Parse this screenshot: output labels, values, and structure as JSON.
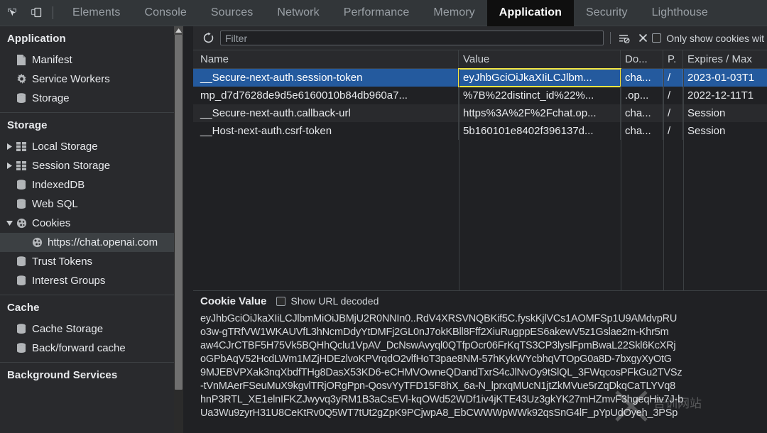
{
  "toolbar": {
    "inspect_icon": "inspect-cursor-icon",
    "device_icon": "device-toolbar-icon",
    "tabs": [
      {
        "label": "Elements",
        "active": false
      },
      {
        "label": "Console",
        "active": false
      },
      {
        "label": "Sources",
        "active": false
      },
      {
        "label": "Network",
        "active": false
      },
      {
        "label": "Performance",
        "active": false
      },
      {
        "label": "Memory",
        "active": false
      },
      {
        "label": "Application",
        "active": true
      },
      {
        "label": "Security",
        "active": false
      },
      {
        "label": "Lighthouse",
        "active": false
      }
    ]
  },
  "sidebar": {
    "sections": [
      {
        "title": "Application",
        "items": [
          {
            "label": "Manifest",
            "icon": "document-icon",
            "twisty": "none",
            "selected": false
          },
          {
            "label": "Service Workers",
            "icon": "gear-icon",
            "twisty": "none",
            "selected": false
          },
          {
            "label": "Storage",
            "icon": "database-icon",
            "twisty": "none",
            "selected": false
          }
        ]
      },
      {
        "title": "Storage",
        "items": [
          {
            "label": "Local Storage",
            "icon": "table-icon",
            "twisty": "collapsed",
            "selected": false
          },
          {
            "label": "Session Storage",
            "icon": "table-icon",
            "twisty": "collapsed",
            "selected": false
          },
          {
            "label": "IndexedDB",
            "icon": "database-icon",
            "twisty": "none",
            "selected": false
          },
          {
            "label": "Web SQL",
            "icon": "database-icon",
            "twisty": "none",
            "selected": false
          },
          {
            "label": "Cookies",
            "icon": "cookie-icon",
            "twisty": "expanded",
            "selected": false
          },
          {
            "label": "https://chat.openai.com",
            "icon": "cookie-icon",
            "twisty": "none",
            "selected": true,
            "deep": true
          },
          {
            "label": "Trust Tokens",
            "icon": "database-icon",
            "twisty": "none",
            "selected": false
          },
          {
            "label": "Interest Groups",
            "icon": "database-icon",
            "twisty": "none",
            "selected": false
          }
        ]
      },
      {
        "title": "Cache",
        "items": [
          {
            "label": "Cache Storage",
            "icon": "database-icon",
            "twisty": "none",
            "selected": false
          },
          {
            "label": "Back/forward cache",
            "icon": "database-icon",
            "twisty": "none",
            "selected": false
          }
        ]
      },
      {
        "title": "Background Services",
        "items": []
      }
    ]
  },
  "filterbar": {
    "refresh_icon": "refresh-icon",
    "filter_placeholder": "Filter",
    "filter_value": "",
    "clear_filtered_icon": "clear-filtered-cookies-icon",
    "clear_all_icon": "close-x-icon",
    "only_show_label": "Only show cookies wit",
    "only_show_checked": false
  },
  "cookie_table": {
    "columns": [
      "Name",
      "Value",
      "Do...",
      "P.",
      "Expires / Max"
    ],
    "rows": [
      {
        "name": "__Secure-next-auth.session-token",
        "value": "eyJhbGciOiJkaXIiLCJlbm...",
        "domain": "cha...",
        "path": "/",
        "expires": "2023-01-03T1",
        "selected": true,
        "value_highlighted": true
      },
      {
        "name": "mp_d7d7628de9d5e6160010b84db960a7...",
        "value": "%7B%22distinct_id%22%...",
        "domain": ".op...",
        "path": "/",
        "expires": "2022-12-11T1",
        "selected": false,
        "value_highlighted": false
      },
      {
        "name": "__Secure-next-auth.callback-url",
        "value": "https%3A%2F%2Fchat.op...",
        "domain": "cha...",
        "path": "/",
        "expires": "Session",
        "selected": false,
        "value_highlighted": false
      },
      {
        "name": "__Host-next-auth.csrf-token",
        "value": "5b160101e8402f396137d...",
        "domain": "cha...",
        "path": "/",
        "expires": "Session",
        "selected": false,
        "value_highlighted": false
      }
    ]
  },
  "value_pane": {
    "title": "Cookie Value",
    "show_url_decoded_label": "Show URL decoded",
    "show_url_decoded_checked": false,
    "lines": [
      "eyJhbGciOiJkaXIiLCJlbmMiOiJBMjU2R0NNIn0..RdV4XRSVNQBKif5C.fyskKjlVCs1AOMFSp1U9AMdvpRU",
      "o3w-gTRfVW1WKAUVfL3hNcmDdyYtDMFj2GL0nJ7okKBll8Fff2XiuRugppES6akewV5z1Gslae2m-Khr5m",
      "aw4CJrCTBF5H75Vk5BQHhQclu1VpAV_DcNswAvyql0QTfpOcr06FrKqTS3CP3lyslFpmBwaL22Skl6KcXRj",
      "oGPbAqV52HcdLWm1MZjHDEzlvoKPVrqdO2vlfHoT3pae8NM-57hKykWYcbhqVTOpG0a8D-7bxgyXyOtG",
      "9MJEBVPXak3nqXbdfTHg8DasX53KD6-eCHMVOwneQDandTxrS4cJlNvOy9tSlQL_3FWqcosPFkGu2TVSz",
      "-tVnMAerFSeuMuX9kgvlTRjORgPpn-QosvYyTFD15F8hX_6a-N_lprxqMUcN1jtZkMVue5rZqDkqCaTLYVq8",
      "hnP3RTL_XE1elnIFKZJwyvq3yRM1B3aCsEVl-kqOWd52WDf1iv4jKTE43Uz3gkYK27mHZmvF3hgeqHiv7J-b",
      "Ua3Wu9zyrH31U8CeKtRv0Q5WT7tUt2gZpK9PCjwpA8_EbCWWWpWWk92qsSnG4lF_pYpUdOyeh_3PSp"
    ]
  },
  "watermark": {
    "text": ""
  },
  "colors": {
    "accent_selected_row": "#245a9e",
    "highlight_outline": "#f5e642",
    "panel_bg": "#202124",
    "sidebar_bg": "#292a2d",
    "tabbar_bg": "#323639",
    "active_tab_bg": "#0f0f0f"
  }
}
